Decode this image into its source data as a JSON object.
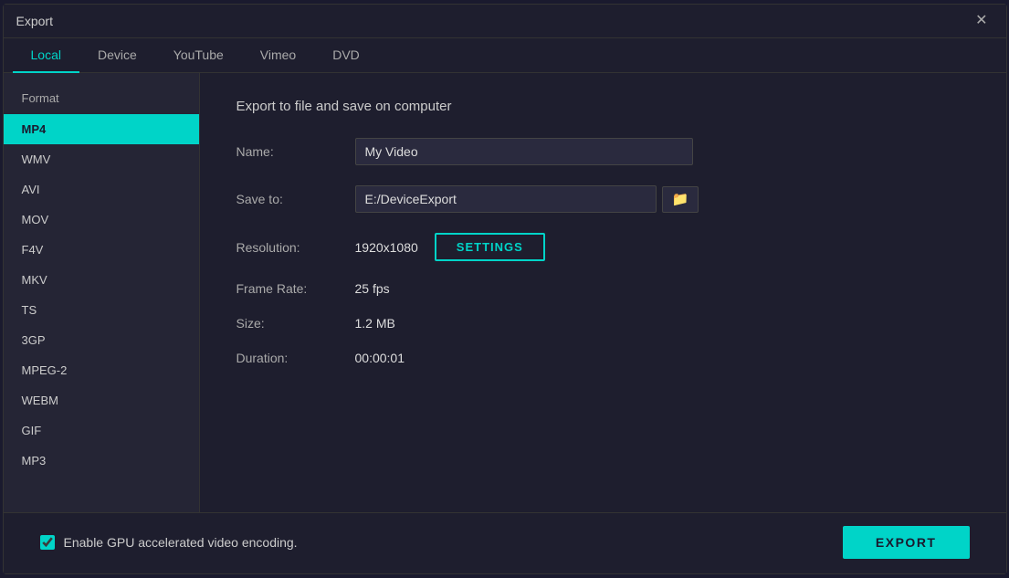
{
  "dialog": {
    "title": "Export"
  },
  "tabs": [
    {
      "id": "local",
      "label": "Local",
      "active": true
    },
    {
      "id": "device",
      "label": "Device",
      "active": false
    },
    {
      "id": "youtube",
      "label": "YouTube",
      "active": false
    },
    {
      "id": "vimeo",
      "label": "Vimeo",
      "active": false
    },
    {
      "id": "dvd",
      "label": "DVD",
      "active": false
    }
  ],
  "sidebar": {
    "title": "Format",
    "items": [
      {
        "label": "MP4",
        "active": true
      },
      {
        "label": "WMV",
        "active": false
      },
      {
        "label": "AVI",
        "active": false
      },
      {
        "label": "MOV",
        "active": false
      },
      {
        "label": "F4V",
        "active": false
      },
      {
        "label": "MKV",
        "active": false
      },
      {
        "label": "TS",
        "active": false
      },
      {
        "label": "3GP",
        "active": false
      },
      {
        "label": "MPEG-2",
        "active": false
      },
      {
        "label": "WEBM",
        "active": false
      },
      {
        "label": "GIF",
        "active": false
      },
      {
        "label": "MP3",
        "active": false
      }
    ]
  },
  "main": {
    "section_title": "Export to file and save on computer",
    "name_label": "Name:",
    "name_value": "My Video",
    "save_to_label": "Save to:",
    "save_to_value": "E:/DeviceExport",
    "resolution_label": "Resolution:",
    "resolution_value": "1920x1080",
    "settings_label": "SETTINGS",
    "frame_rate_label": "Frame Rate:",
    "frame_rate_value": "25 fps",
    "size_label": "Size:",
    "size_value": "1.2 MB",
    "duration_label": "Duration:",
    "duration_value": "00:00:01"
  },
  "footer": {
    "gpu_label": "Enable GPU accelerated video encoding.",
    "export_label": "EXPORT"
  },
  "icons": {
    "close": "✕",
    "folder": "🗀"
  }
}
